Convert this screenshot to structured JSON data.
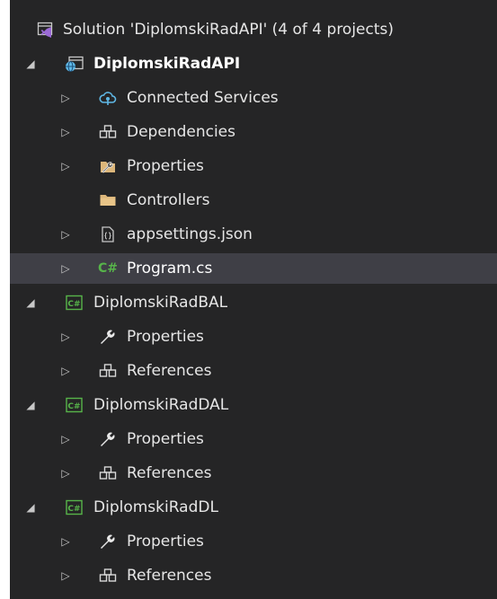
{
  "solution_explorer": {
    "solution": {
      "label": "Solution 'DiplomskiRadAPI' (4 of 4 projects)"
    },
    "projects": [
      {
        "name": "DiplomskiRadAPI",
        "items": [
          {
            "label": "Connected Services",
            "icon": "connected-services-icon"
          },
          {
            "label": "Dependencies",
            "icon": "dependencies-icon"
          },
          {
            "label": "Properties",
            "icon": "properties-wrench-folder-icon"
          },
          {
            "label": "Controllers",
            "icon": "folder-icon"
          },
          {
            "label": "appsettings.json",
            "icon": "json-file-icon"
          },
          {
            "label": "Program.cs",
            "icon": "csharp-file-icon"
          }
        ]
      },
      {
        "name": "DiplomskiRadBAL",
        "items": [
          {
            "label": "Properties",
            "icon": "wrench-icon"
          },
          {
            "label": "References",
            "icon": "references-icon"
          }
        ]
      },
      {
        "name": "DiplomskiRadDAL",
        "items": [
          {
            "label": "Properties",
            "icon": "wrench-icon"
          },
          {
            "label": "References",
            "icon": "references-icon"
          }
        ]
      },
      {
        "name": "DiplomskiRadDL",
        "items": [
          {
            "label": "Properties",
            "icon": "wrench-icon"
          },
          {
            "label": "References",
            "icon": "references-icon"
          }
        ]
      }
    ],
    "icons": {
      "expand_collapsed": "▷",
      "expand_expanded": "◢",
      "csharp_text": "C#"
    },
    "colors": {
      "background": "#252526",
      "selected_row": "#3f3f46",
      "text": "#e6e6e6",
      "folder": "#dcb67a",
      "csharp": "#57b44a",
      "connected_services": "#5fb8e6",
      "vs_purple": "#9b6ad6",
      "json_file": "#c8c8c8"
    }
  }
}
